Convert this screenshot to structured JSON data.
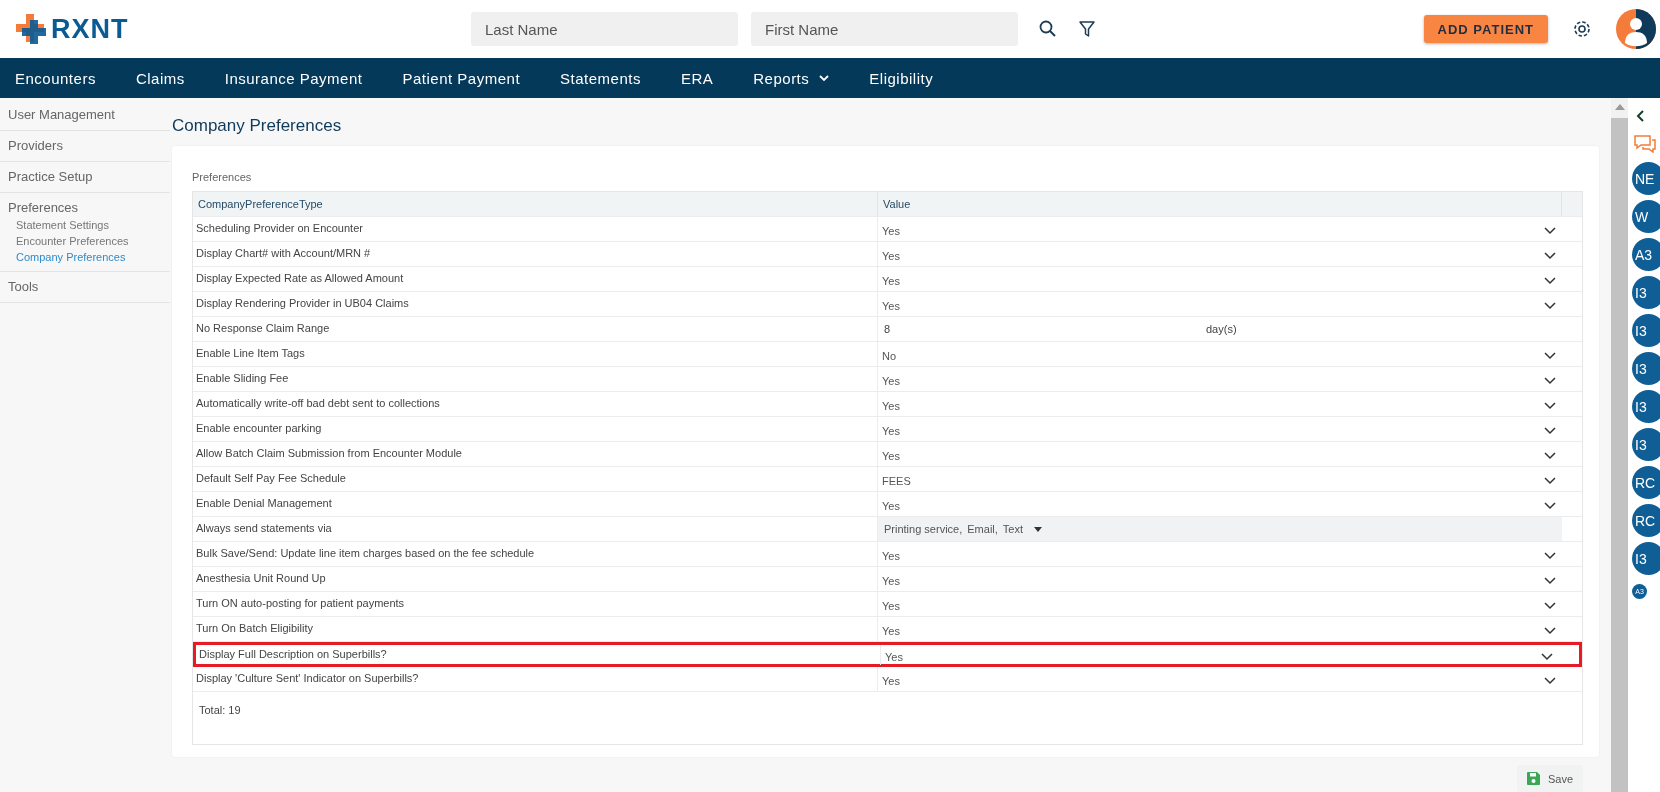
{
  "header": {
    "logo": "RXNT",
    "search_fields": [
      {
        "placeholder": "Last Name"
      },
      {
        "placeholder": "First Name"
      }
    ],
    "add_button": "ADD PATIENT"
  },
  "nav": [
    {
      "label": "Encounters",
      "dropdown": false
    },
    {
      "label": "Claims",
      "dropdown": false
    },
    {
      "label": "Insurance Payment",
      "dropdown": false
    },
    {
      "label": "Patient Payment",
      "dropdown": false
    },
    {
      "label": "Statements",
      "dropdown": false
    },
    {
      "label": "ERA",
      "dropdown": false
    },
    {
      "label": "Reports",
      "dropdown": true
    },
    {
      "label": "Eligibility",
      "dropdown": false
    }
  ],
  "sidebar": {
    "items": [
      {
        "label": "User Management"
      },
      {
        "label": "Providers"
      },
      {
        "label": "Practice Setup"
      },
      {
        "label": "Preferences",
        "children": [
          {
            "label": "Statement Settings",
            "selected": false
          },
          {
            "label": "Encounter Preferences",
            "selected": false
          },
          {
            "label": "Company Preferences",
            "selected": true
          }
        ]
      },
      {
        "label": "Tools"
      }
    ]
  },
  "page_title": "Company Preferences",
  "section_label": "Preferences",
  "table": {
    "columns": [
      "CompanyPreferenceType",
      "Value"
    ],
    "rows": [
      {
        "type": "Scheduling Provider on Encounter",
        "kind": "select",
        "value": "Yes",
        "highlighted": false
      },
      {
        "type": "Display Chart# with Account/MRN #",
        "kind": "select",
        "value": "Yes",
        "highlighted": false
      },
      {
        "type": "Display Expected Rate as Allowed Amount",
        "kind": "select",
        "value": "Yes",
        "highlighted": false
      },
      {
        "type": "Display Rendering Provider in UB04 Claims",
        "kind": "select",
        "value": "Yes",
        "highlighted": false
      },
      {
        "type": "No Response Claim Range",
        "kind": "number",
        "value": "8",
        "unit": "day(s)",
        "highlighted": false
      },
      {
        "type": "Enable Line Item Tags",
        "kind": "select",
        "value": "No",
        "highlighted": false
      },
      {
        "type": "Enable Sliding Fee",
        "kind": "select",
        "value": "Yes",
        "highlighted": false
      },
      {
        "type": "Automatically write-off bad debt sent to collections",
        "kind": "select",
        "value": "Yes",
        "highlighted": false
      },
      {
        "type": "Enable encounter parking",
        "kind": "select",
        "value": "Yes",
        "highlighted": false
      },
      {
        "type": "Allow Batch Claim Submission from Encounter Module",
        "kind": "select",
        "value": "Yes",
        "highlighted": false
      },
      {
        "type": "Default Self Pay Fee Schedule",
        "kind": "select",
        "value": "FEES",
        "highlighted": false
      },
      {
        "type": "Enable Denial Management",
        "kind": "select",
        "value": "Yes",
        "highlighted": false
      },
      {
        "type": "Always send statements via",
        "kind": "multiselect",
        "options": [
          "Printing service,",
          "Email,",
          "Text"
        ],
        "highlighted": false
      },
      {
        "type": "Bulk Save/Send: Update line item charges based on the fee schedule",
        "kind": "select",
        "value": "Yes",
        "highlighted": false
      },
      {
        "type": "Anesthesia Unit Round Up",
        "kind": "select",
        "value": "Yes",
        "highlighted": false
      },
      {
        "type": "Turn ON auto-posting for patient payments",
        "kind": "select",
        "value": "Yes",
        "highlighted": false
      },
      {
        "type": "Turn On Batch Eligibility",
        "kind": "select",
        "value": "Yes",
        "highlighted": false
      },
      {
        "type": "Display Full Description on Superbills?",
        "kind": "select",
        "value": "Yes",
        "highlighted": true
      },
      {
        "type": "Display 'Culture Sent' Indicator on Superbills?",
        "kind": "select",
        "value": "Yes",
        "highlighted": false
      }
    ],
    "total": "Total: 19"
  },
  "save_button": "Save",
  "right_panel": {
    "avatars": [
      "NE",
      "W",
      "A3",
      "I3",
      "I3",
      "I3",
      "I3",
      "I3",
      "RC",
      "RC",
      "I3"
    ],
    "small_badge": "A3"
  }
}
